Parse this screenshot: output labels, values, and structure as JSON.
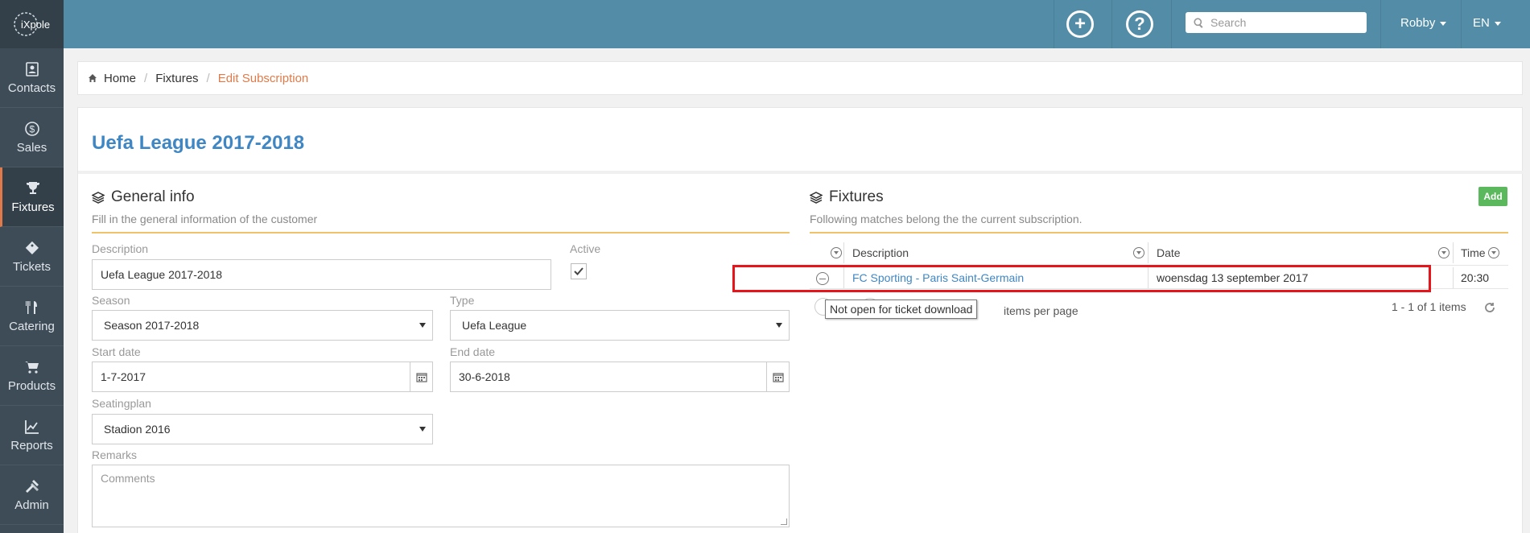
{
  "app": {
    "logo_text": "iXpole"
  },
  "sidebar": {
    "items": [
      {
        "label": "Contacts",
        "icon": "contacts-icon"
      },
      {
        "label": "Sales",
        "icon": "dollar-icon"
      },
      {
        "label": "Fixtures",
        "icon": "trophy-icon",
        "active": true
      },
      {
        "label": "Tickets",
        "icon": "ticket-icon"
      },
      {
        "label": "Catering",
        "icon": "cutlery-icon"
      },
      {
        "label": "Products",
        "icon": "cart-icon"
      },
      {
        "label": "Reports",
        "icon": "chart-icon"
      },
      {
        "label": "Admin",
        "icon": "tools-icon"
      }
    ]
  },
  "topbar": {
    "add_icon": "plus-circle-icon",
    "help_icon": "question-circle-icon",
    "search_placeholder": "Search",
    "user": "Robby",
    "language": "EN"
  },
  "breadcrumb": {
    "home": "Home",
    "fixtures": "Fixtures",
    "current": "Edit Subscription"
  },
  "page": {
    "title": "Uefa League 2017-2018"
  },
  "general": {
    "heading": "General info",
    "subtitle": "Fill in the general information of the customer",
    "description_label": "Description",
    "description_value": "Uefa League 2017-2018",
    "active_label": "Active",
    "season_label": "Season",
    "season_value": "Season 2017-2018",
    "type_label": "Type",
    "type_value": "Uefa League",
    "start_label": "Start date",
    "start_value": "1-7-2017",
    "end_label": "End date",
    "end_value": "30-6-2018",
    "seating_label": "Seatingplan",
    "seating_value": "Stadion 2016",
    "remarks_label": "Remarks",
    "remarks_placeholder": "Comments"
  },
  "fixtures": {
    "heading": "Fixtures",
    "subtitle": "Following matches belong the the current subscription.",
    "add_label": "Add",
    "columns": [
      "Description",
      "Date",
      "Time"
    ],
    "rows": [
      {
        "description": "FC Sporting - Paris Saint-Germain",
        "date": "woensdag 13 september 2017",
        "time": "20:30"
      }
    ],
    "tooltip": "Not open for ticket download",
    "items_per_page": "items per page",
    "range": "1 - 1 of 1 items"
  },
  "colors": {
    "accent": "#3f87c4",
    "topbar": "#538ca6",
    "sidebar": "#3e4c57",
    "active_marker": "#e07a4a",
    "highlight": "#e8141c",
    "add": "#5cb85c"
  }
}
